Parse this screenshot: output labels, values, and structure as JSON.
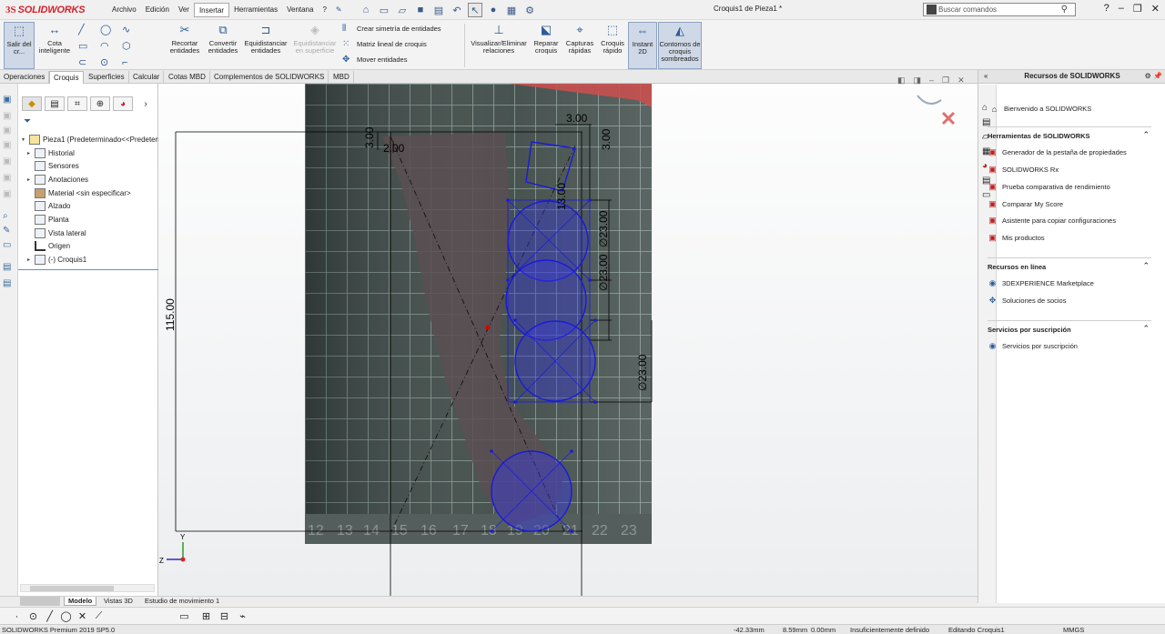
{
  "app": {
    "logo_ds": "3S",
    "logo_text": "SOLIDWORKS",
    "doc_title": "Croquis1 de Pieza1 *"
  },
  "menu": [
    "Archivo",
    "Edición",
    "Ver",
    "Insertar",
    "Herramientas",
    "Ventana",
    "?"
  ],
  "search": {
    "placeholder": "Buscar comandos"
  },
  "commands": {
    "exit_sketch": "Salir del cr...",
    "smart_dim": "Cota inteligente",
    "trim": "Recortar entidades",
    "convert": "Convertir entidades",
    "offset": "Equidistanciar entidades",
    "offset_surface": "Equidistanciar en superficie",
    "mirror": "Crear simetría de entidades",
    "linear_pattern": "Matriz lineal de croquis",
    "move": "Mover entidades",
    "relations": "Visualizar/Eliminar relaciones",
    "repair": "Reparar croquis",
    "quick_snaps": "Capturas rápidas",
    "rapid_sketch": "Croquis rápido",
    "instant2d": "Instant 2D",
    "shaded": "Contornos de croquis sombreados"
  },
  "cmd_tabs": [
    "Operaciones",
    "Croquis",
    "Superficies",
    "Calcular",
    "Cotas MBD",
    "Complementos de SOLIDWORKS",
    "MBD"
  ],
  "tree": {
    "root": "Pieza1  (Predeterminado<<Predeterm",
    "items": [
      {
        "label": "Historial",
        "expand": true
      },
      {
        "label": "Sensores",
        "expand": false
      },
      {
        "label": "Anotaciones",
        "expand": true
      },
      {
        "label": "Material <sin especificar>",
        "expand": false
      },
      {
        "label": "Alzado",
        "expand": false
      },
      {
        "label": "Planta",
        "expand": false
      },
      {
        "label": "Vista lateral",
        "expand": false
      },
      {
        "label": "Origen",
        "expand": false
      },
      {
        "label": "(-) Croquis1",
        "expand": true
      }
    ]
  },
  "dims": {
    "d_top_right": "3.00",
    "d_top_left": "3.00",
    "d_2": "2.00",
    "d_right_v": "3.00",
    "d_13": "13.00",
    "d_c1": "∅23.00",
    "d_c2": "∅23.00",
    "d_c3": "∅23.00",
    "d_height": "115.00"
  },
  "ruler_numbers": [
    "12",
    "13",
    "14",
    "15",
    "16",
    "17",
    "18",
    "19",
    "20",
    "21",
    "22",
    "23"
  ],
  "taskpane": {
    "title": "Recursos de SOLIDWORKS",
    "welcome": "Bienvenido a SOLIDWORKS",
    "sec_tools": "Herramientas de SOLIDWORKS",
    "tools": [
      "Generador de la pestaña de propiedades",
      "SOLIDWORKS Rx",
      "Prueba comparativa de rendimiento",
      "Comparar My Score",
      "Asistente para copiar configuraciones",
      "Mis productos"
    ],
    "sec_online": "Recursos en línea",
    "online": [
      "3DEXPERIENCE Marketplace",
      "Soluciones de socios"
    ],
    "sec_sub": "Servicios por suscripción",
    "sub": [
      "Servicios por suscripción"
    ]
  },
  "bottom_tabs": [
    "Modelo",
    "Vistas 3D",
    "Estudio de movimiento 1"
  ],
  "status": {
    "product": "SOLIDWORKS Premium 2019 SP5.0",
    "x": "-42.33mm",
    "y": "8.59mm",
    "z": "0.00mm",
    "state": "Insuficientemente definido",
    "editing": "Editando Croquis1",
    "units": "MMGS"
  },
  "colors": {
    "sketch_blue": "#1a1ad8",
    "brand_red": "#d8202a"
  }
}
